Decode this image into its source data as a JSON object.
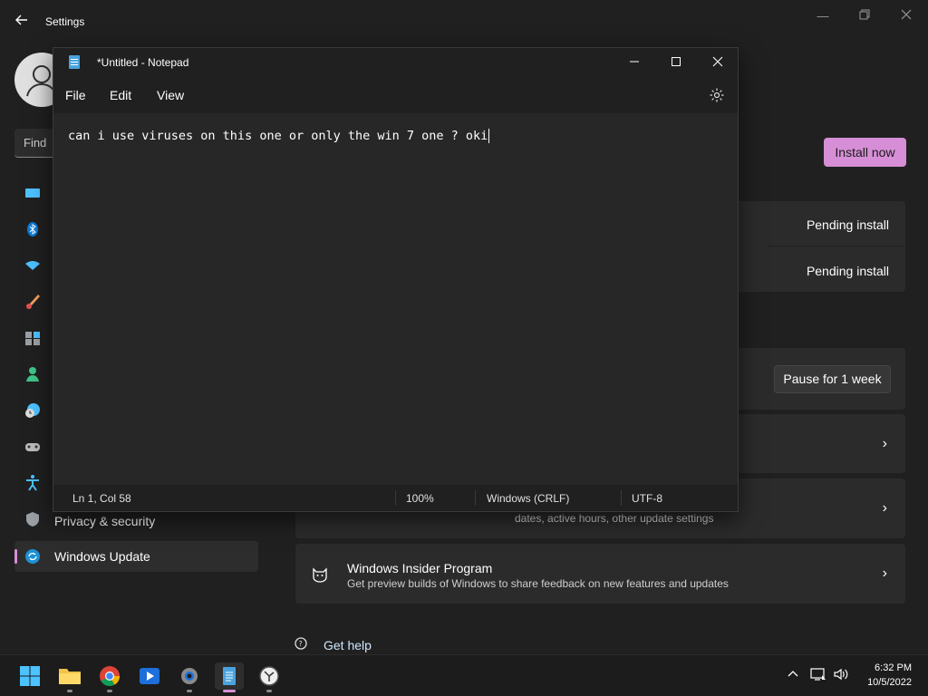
{
  "settings": {
    "title": "Settings",
    "find_placeholder": "Find",
    "nav": {
      "privacy_label": "Privacy & security",
      "windows_update_label": "Windows Update"
    },
    "install_now_label": "Install now",
    "pending": [
      "Pending install",
      "Pending install"
    ],
    "pause_label": "Pause for 1 week",
    "advanced_sub_fragment": "dates, active hours, other update settings",
    "insider": {
      "title": "Windows Insider Program",
      "subtitle": "Get preview builds of Windows to share feedback on new features and updates"
    },
    "get_help_label": "Get help"
  },
  "notepad": {
    "title": "*Untitled - Notepad",
    "menu": [
      "File",
      "Edit",
      "View"
    ],
    "content": "can i use viruses on this one or only the win 7 one ? oki",
    "status": {
      "position": "Ln 1, Col 58",
      "zoom": "100%",
      "line_ending": "Windows (CRLF)",
      "encoding": "UTF-8"
    }
  },
  "taskbar": {
    "time": "6:32 PM",
    "date": "10/5/2022"
  },
  "colors": {
    "accent": "#d68fd6",
    "background": "#202020",
    "card": "#2b2b2b"
  }
}
